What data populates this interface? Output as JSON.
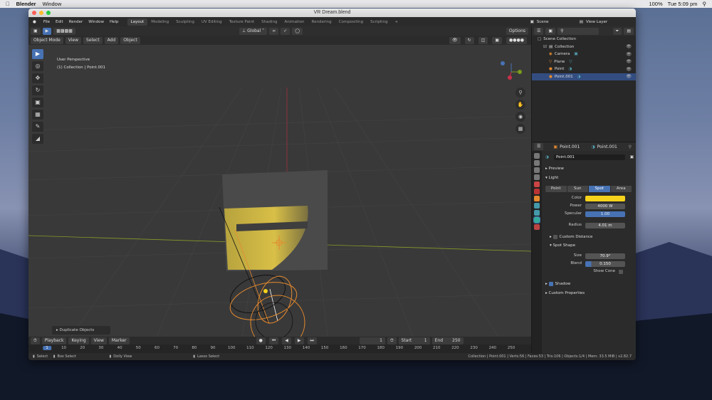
{
  "mac": {
    "app": "Blender",
    "menu": "Window",
    "time": "Tue 5:09 pm",
    "battery": "100%"
  },
  "window": {
    "title": "VR Dream.blend"
  },
  "menus": [
    "File",
    "Edit",
    "Render",
    "Window",
    "Help"
  ],
  "workspaces": [
    "Layout",
    "Modeling",
    "Sculpting",
    "UV Editing",
    "Texture Paint",
    "Shading",
    "Animation",
    "Rendering",
    "Compositing",
    "Scripting"
  ],
  "scene": "Scene",
  "view_layer": "View Layer",
  "transform": {
    "orientation": "Global",
    "options": "Options"
  },
  "header": {
    "mode": "Object Mode",
    "menus": [
      "View",
      "Select",
      "Add",
      "Object"
    ]
  },
  "viewport": {
    "view_name": "User Perspective",
    "context": "(1) Collection | Point.001",
    "redo_panel": "Duplicate Objects"
  },
  "timeline": {
    "menus": [
      "Playback",
      "Keying",
      "View",
      "Marker"
    ],
    "current": "1",
    "start_label": "Start",
    "start": "1",
    "end_label": "End",
    "end": "250",
    "ticks": [
      "1",
      "10",
      "20",
      "30",
      "40",
      "50",
      "60",
      "70",
      "80",
      "90",
      "100",
      "110",
      "120",
      "130",
      "140",
      "150",
      "160",
      "170",
      "180",
      "190",
      "200",
      "210",
      "220",
      "230",
      "240",
      "250"
    ]
  },
  "status": {
    "select": "Select",
    "box": "Box Select",
    "dolly": "Dolly View",
    "lasso": "Lasso Select",
    "stats": "Collection | Point.001 | Verts:56 | Faces:53 | Tris:106 | Objects:1/4 | Mem: 33.5 MiB | v2.82.7"
  },
  "outliner": {
    "root": "Scene Collection",
    "collection": "Collection",
    "items": [
      "Camera",
      "Plane",
      "Point",
      "Point.001"
    ]
  },
  "properties": {
    "object": "Point.001",
    "data": "Point.001",
    "data_name": "Point.001",
    "preview": "Preview",
    "light": "Light",
    "types": [
      "Point",
      "Sun",
      "Spot",
      "Area"
    ],
    "color_label": "Color",
    "power_label": "Power",
    "power": "4000 W",
    "specular_label": "Specular",
    "specular": "1.00",
    "radius_label": "Radius",
    "radius": "4.01 m",
    "custom_distance": "Custom Distance",
    "spot_shape": "Spot Shape",
    "size_label": "Size",
    "size": "70.9°",
    "blend_label": "Blend",
    "blend": "0.150",
    "show_cone": "Show Cone",
    "shadow": "Shadow",
    "custom_props": "Custom Properties"
  },
  "colors": {
    "accent": "#4772b3",
    "light_color": "#f5d21b",
    "selected_row": "#334d80"
  }
}
